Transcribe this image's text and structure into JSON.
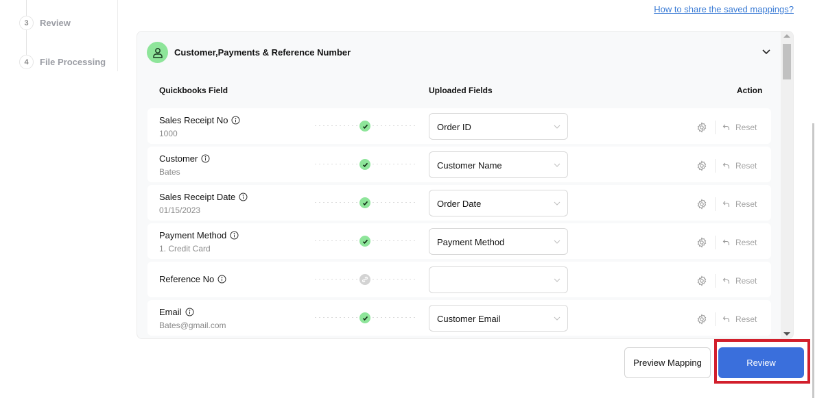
{
  "steps": [
    {
      "number": "3",
      "label": "Review"
    },
    {
      "number": "4",
      "label": "File Processing"
    }
  ],
  "help_link": "How to share the saved mappings?",
  "panel": {
    "icon": "user-icon",
    "title": "Customer,Payments & Reference Number",
    "columns": {
      "quickbooks_field": "Quickbooks Field",
      "uploaded_fields": "Uploaded Fields",
      "action": "Action"
    },
    "rows": [
      {
        "field": "Sales Receipt No",
        "sample": "1000",
        "status": "mapped",
        "uploaded": "Order ID",
        "reset": "Reset"
      },
      {
        "field": "Customer",
        "sample": "Bates",
        "status": "mapped",
        "uploaded": "Customer Name",
        "reset": "Reset"
      },
      {
        "field": "Sales Receipt Date",
        "sample": "01/15/2023",
        "status": "mapped",
        "uploaded": "Order Date",
        "reset": "Reset"
      },
      {
        "field": "Payment Method",
        "sample": "1. Credit Card",
        "status": "mapped",
        "uploaded": "Payment Method",
        "reset": "Reset"
      },
      {
        "field": "Reference No",
        "sample": "",
        "status": "unmapped",
        "uploaded": "",
        "reset": "Reset"
      },
      {
        "field": "Email",
        "sample": "Bates@gmail.com",
        "status": "mapped",
        "uploaded": "Customer Email",
        "reset": "Reset"
      }
    ]
  },
  "buttons": {
    "preview_mapping": "Preview Mapping",
    "review": "Review"
  },
  "colors": {
    "primary": "#3a6fdc",
    "success": "#8ee59a",
    "highlight": "#d21f2c",
    "link": "#3a7bd5"
  }
}
